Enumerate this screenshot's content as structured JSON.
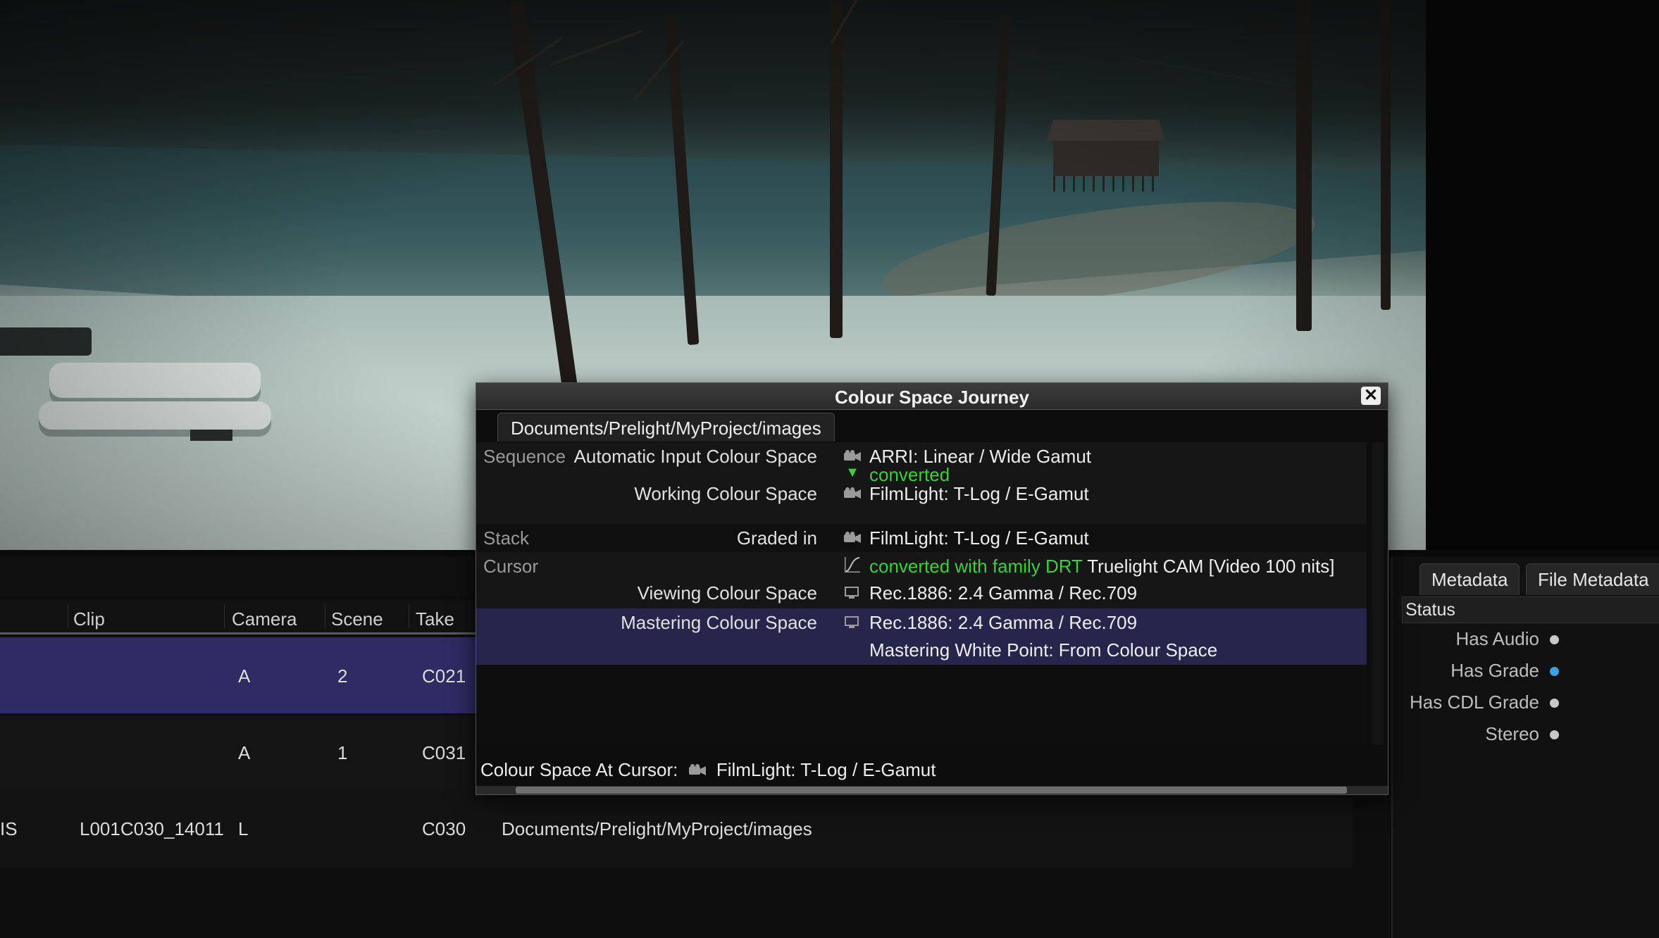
{
  "dialog": {
    "title": "Colour Space Journey",
    "close_label": "✕",
    "path_tab": "Documents/Prelight/MyProject/images",
    "sections": {
      "sequence": "Sequence",
      "stack": "Stack",
      "cursor": "Cursor"
    },
    "rows": {
      "auto_input_key": "Automatic Input Colour Space",
      "auto_input_val": "ARRI: Linear / Wide Gamut",
      "converted_marker": "▼",
      "converted": "converted",
      "working_key": "Working Colour Space",
      "working_val": "FilmLight: T-Log / E-Gamut",
      "graded_key": "Graded in",
      "graded_val": "FilmLight: T-Log / E-Gamut",
      "drt_green": "converted with family DRT",
      "drt_val": "Truelight CAM [Video 100 nits]",
      "viewing_key": "Viewing Colour Space",
      "viewing_val": "Rec.1886: 2.4 Gamma / Rec.709",
      "mastering_key": "Mastering Colour Space",
      "mastering_val": "Rec.1886: 2.4 Gamma / Rec.709",
      "white_point": "Mastering White Point: From Colour Space"
    },
    "footer_label": "Colour Space At Cursor:",
    "footer_value": "FilmLight: T-Log / E-Gamut"
  },
  "table": {
    "columns": [
      "Clip",
      "Camera",
      "Scene",
      "Take"
    ],
    "rows": [
      {
        "clip": "",
        "camera": "A",
        "scene": "2",
        "take": "C021"
      },
      {
        "clip": "",
        "camera": "A",
        "scene": "1",
        "take": "C031"
      }
    ],
    "row3": {
      "lead": "IS",
      "clip": "L001C030_14011",
      "camera": "L",
      "take": "C030",
      "path": "Documents/Prelight/MyProject/images"
    }
  },
  "metadata": {
    "tabs": [
      "Metadata",
      "File Metadata"
    ],
    "status_header": "Status",
    "items": [
      {
        "label": "Has Audio",
        "color": "#c8c8c8"
      },
      {
        "label": "Has Grade",
        "color": "#3aa0e8"
      },
      {
        "label": "Has CDL Grade",
        "color": "#c8c8c8"
      },
      {
        "label": "Stereo",
        "color": "#c8c8c8"
      }
    ]
  },
  "icons": {
    "camera": "camera-icon",
    "monitor": "monitor-icon",
    "curve": "curve-icon",
    "close": "close-icon"
  }
}
